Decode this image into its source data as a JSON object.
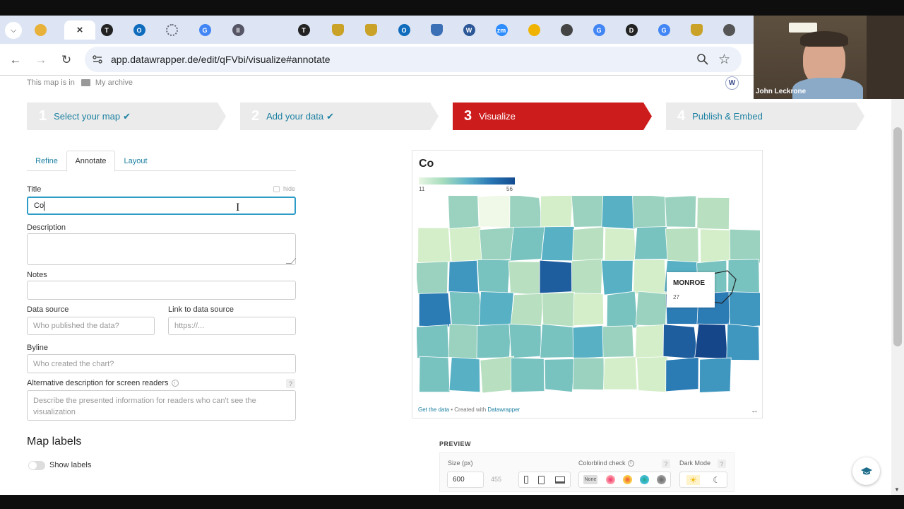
{
  "browser": {
    "url": "app.datawrapper.de/edit/qFVbi/visualize#annotate",
    "tabs": [
      {
        "icon": "circle-logo-icon",
        "color": "#e8b13a",
        "text": ""
      },
      {
        "icon": "close-icon",
        "color": "#555",
        "text": "×"
      },
      {
        "icon": "nyt-icon",
        "color": "#222",
        "text": "T"
      },
      {
        "icon": "outlook-icon",
        "color": "#0f6cbd",
        "text": "O"
      },
      {
        "icon": "spinner-icon",
        "color": "#667",
        "text": ""
      },
      {
        "icon": "google-icon",
        "color": "#4285f4",
        "text": "G"
      },
      {
        "icon": "pause-icon",
        "color": "#556",
        "text": "II"
      },
      {
        "icon": "nyt-icon",
        "color": "#222",
        "text": "T"
      },
      {
        "icon": "shield-icon",
        "color": "#c9a227",
        "text": ""
      },
      {
        "icon": "shield-icon",
        "color": "#c9a227",
        "text": ""
      },
      {
        "icon": "outlook-icon",
        "color": "#0f6cbd",
        "text": "O"
      },
      {
        "icon": "shield-icon",
        "color": "#3b6fb6",
        "text": ""
      },
      {
        "icon": "word-icon",
        "color": "#2b5797",
        "text": "W"
      },
      {
        "icon": "zoom-icon",
        "color": "#2d8cff",
        "text": "zm"
      },
      {
        "icon": "sun-icon",
        "color": "#f0b400",
        "text": ""
      },
      {
        "icon": "tag-icon",
        "color": "#444",
        "text": ""
      },
      {
        "icon": "google-icon",
        "color": "#4285f4",
        "text": "G"
      },
      {
        "icon": "d-icon",
        "color": "#222",
        "text": "D"
      },
      {
        "icon": "google-icon",
        "color": "#4285f4",
        "text": "G"
      },
      {
        "icon": "shield-icon",
        "color": "#c9a227",
        "text": ""
      },
      {
        "icon": "globe-icon",
        "color": "#555",
        "text": ""
      }
    ]
  },
  "webcam": {
    "name": "John Leckrone"
  },
  "archive": {
    "prefix": "This map is in",
    "folder": "My archive",
    "avatar": "W"
  },
  "steps": [
    {
      "num": "1",
      "label": "Select your map",
      "check": "✔"
    },
    {
      "num": "2",
      "label": "Add your data",
      "check": "✔"
    },
    {
      "num": "3",
      "label": "Visualize",
      "check": ""
    },
    {
      "num": "4",
      "label": "Publish & Embed",
      "check": ""
    }
  ],
  "subtabs": {
    "refine": "Refine",
    "annotate": "Annotate",
    "layout": "Layout"
  },
  "form": {
    "title_label": "Title",
    "hide_label": "hide",
    "title_value": "Co",
    "description_label": "Description",
    "notes_label": "Notes",
    "data_source_label": "Data source",
    "data_source_placeholder": "Who published the data?",
    "link_label": "Link to data source",
    "link_placeholder": "https://...",
    "byline_label": "Byline",
    "byline_placeholder": "Who created the chart?",
    "alt_label": "Alternative description for screen readers",
    "alt_placeholder": "Describe the presented information for readers who can't see the visualization",
    "map_labels_heading": "Map labels",
    "show_labels": "Show labels"
  },
  "map": {
    "title": "Co",
    "legend_min": "11",
    "legend_max": "56",
    "tooltip_name": "MONROE",
    "tooltip_value": "27",
    "footer_get": "Get the data",
    "footer_sep": " • Created with ",
    "footer_dw": "Datawrapper",
    "colors": [
      "#f0f8e8",
      "#d4eec9",
      "#b8e0c0",
      "#9ad2bf",
      "#78c2c0",
      "#57b0c4",
      "#3f97c0",
      "#2b7bb5",
      "#1f5e9e",
      "#15468a"
    ]
  },
  "preview": {
    "heading": "PREVIEW",
    "size_label": "Size (px)",
    "width": "600",
    "height": "455",
    "colorblind_label": "Colorblind check",
    "none_label": "None",
    "dark_label": "Dark Mode"
  }
}
